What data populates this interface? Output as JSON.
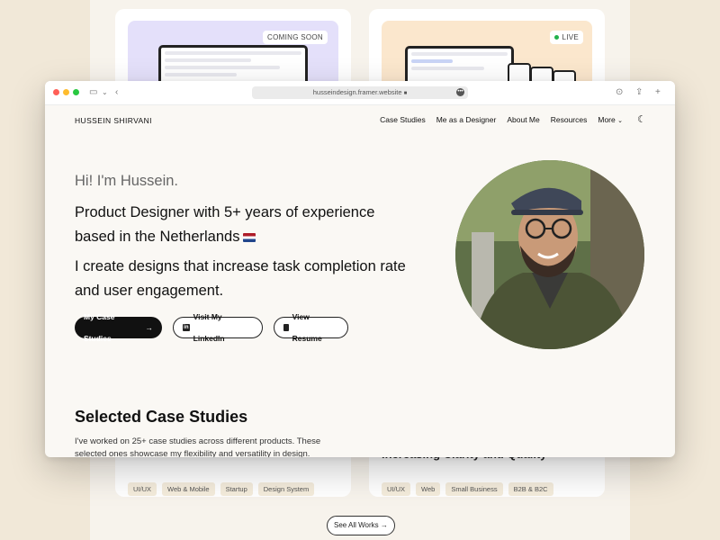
{
  "background": {
    "cards": [
      {
        "badge": "COMING SOON",
        "tags": [
          "UI/UX",
          "Web & Mobile",
          "Startup",
          "Design System"
        ]
      },
      {
        "badge": "LIVE",
        "tags": [
          "UI/UX",
          "Web",
          "Small Business",
          "B2B & B2C"
        ],
        "subtitle_partial": "Increasing Clarity and Quality"
      }
    ],
    "see_all_label": "See All Works",
    "see_all_icon": "arrow-right-icon"
  },
  "browser": {
    "url": "husseindesign.framer.website",
    "url_icon": "lock-icon",
    "toolbar_icons": [
      "sidebar-icon",
      "chevron-down-icon",
      "back-icon",
      "download-icon",
      "share-icon",
      "new-tab-icon"
    ],
    "traffic_lights": [
      "#ff5f57",
      "#febc2e",
      "#28c840"
    ]
  },
  "site": {
    "logo": "HUSSEIN SHIRVANI",
    "nav": [
      "Case Studies",
      "Me as a Designer",
      "About Me",
      "Resources",
      "More"
    ],
    "more_icon": "chevron-down-icon",
    "theme_icon": "moon-icon",
    "hero": {
      "greeting": "Hi! I'm Hussein.",
      "line1": "Product Designer with 5+ years of experience based in the Netherlands",
      "line1_icon": "netherlands-flag-icon",
      "line2": "I create designs that increase task completion rate and user engagement.",
      "buttons": {
        "primary": "My Case Studies",
        "linkedin": "Visit My LinkedIn",
        "resume": "View Resume"
      }
    },
    "selected": {
      "title": "Selected Case Studies",
      "desc": "I've worked on 25+ case studies across different products. These selected ones showcase my flexibility and versatility in design."
    }
  },
  "colors": {
    "page_bg": "#f1e8d8",
    "site_bg": "#faf8f4",
    "primary_button": "#111111",
    "live_dot": "#22b14c"
  }
}
